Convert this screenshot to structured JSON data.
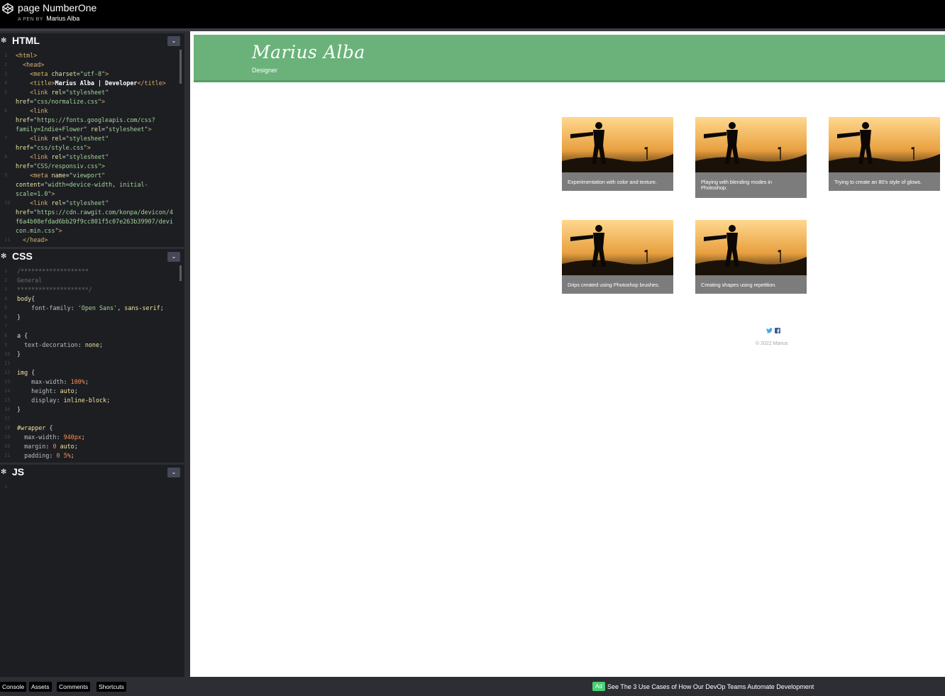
{
  "topbar": {
    "title": "page NumberOne",
    "by_label": "A PEN BY",
    "author": "Marius Alba"
  },
  "editors": {
    "html": {
      "title": "HTML"
    },
    "css": {
      "title": "CSS"
    },
    "js": {
      "title": "JS"
    }
  },
  "html_code": {
    "line_numbers": [
      "1",
      "2",
      "3",
      "4",
      "5",
      "",
      "6",
      "",
      "",
      "7",
      "",
      "8",
      "",
      "9",
      "",
      "10",
      "",
      "",
      "",
      "11"
    ],
    "lines": [
      "<html>",
      "  <head>",
      "    <meta charset=\"utf-8\">",
      "    <title>Marius Alba | Developer</title>",
      "    <link rel=\"stylesheet\"",
      "href=\"css/normalize.css\">",
      "    <link",
      "href=\"https://fonts.googleapis.com/css?",
      "family=Indie+Flower\" rel=\"stylesheet\">",
      "    <link rel=\"stylesheet\"",
      "href=\"css/style.css\">",
      "    <link rel=\"stylesheet\"",
      "href=\"CSS/responsiv.css\">",
      "    <meta name=\"viewport\"",
      "content=\"width=device-width, initial-",
      "scale=1.0\">",
      "    <link rel=\"stylesheet\"",
      "href=\"https://cdn.rawgit.com/konpa/devicon/4",
      "f6a4b08efdad6bb29f9cc801f5c07e263b39907/devi",
      "con.min.css\">",
      "  </head>"
    ]
  },
  "css_code": {
    "lines": [
      "/*******************",
      "General",
      "********************/",
      "body{",
      "    font-family: 'Open Sans', sans-serif;",
      "}",
      "",
      "a {",
      "  text-decoration: none;",
      "}",
      "",
      "img {",
      "    max-width: 100%;",
      "    height: auto;",
      "    display: inline-block;",
      "}",
      "",
      "#wrapper {",
      "  max-width: 940px;",
      "  margin: 0 auto;",
      "  padding: 0 5%;"
    ]
  },
  "js_code": {
    "lines": [
      ""
    ]
  },
  "preview": {
    "site_name": "Marius Alba",
    "site_role": "Designer",
    "gallery": [
      {
        "caption": "Experimentation with color and texture."
      },
      {
        "caption": "Playing with blending modes in Photoshop."
      },
      {
        "caption": "Trying to create an 80's style of glows."
      },
      {
        "caption": "Drips created using Photoshop brushes."
      },
      {
        "caption": "Creating shapes using repetition."
      }
    ],
    "twitter_icon": "twitter-icon",
    "facebook_icon": "facebook-icon",
    "copyright": "© 2022 Marius"
  },
  "bottombar": {
    "console": "Console",
    "assets": "Assets",
    "comments": "Comments",
    "shortcuts": "Shortcuts",
    "ad_badge": "Ad",
    "ad_text": "See The 3 Use Cases of How Our DevOp Teams Automate Development"
  },
  "colors": {
    "header_green": "#6ab27a",
    "editor_bg": "#1d1e22",
    "caption_bg": "#7c7c7c",
    "ad_green": "#47cf73"
  }
}
